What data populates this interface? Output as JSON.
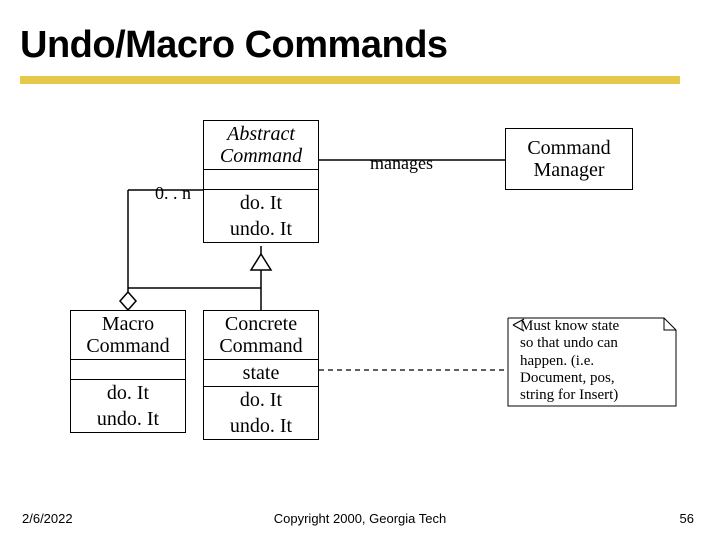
{
  "title": "Undo/Macro Commands",
  "abstract": {
    "name": "Abstract Command",
    "ops1": "do. It",
    "ops2": "undo. It"
  },
  "macro": {
    "name": "Macro Command",
    "ops1": "do. It",
    "ops2": "undo. It"
  },
  "concrete": {
    "name": "Concrete Command",
    "state": "state",
    "ops1": "do. It",
    "ops2": "undo. It"
  },
  "manager": {
    "name": "Command Manager"
  },
  "labels": {
    "multiplicity": "0. . n",
    "manages": "manages"
  },
  "note": {
    "l1": "Must know state",
    "l2": "so that undo can",
    "l3": "happen. (i.e.",
    "l4": "Document, pos,",
    "l5": "string for Insert)"
  },
  "footer": {
    "date": "2/6/2022",
    "copyright": "Copyright 2000, Georgia Tech",
    "page": "56"
  }
}
